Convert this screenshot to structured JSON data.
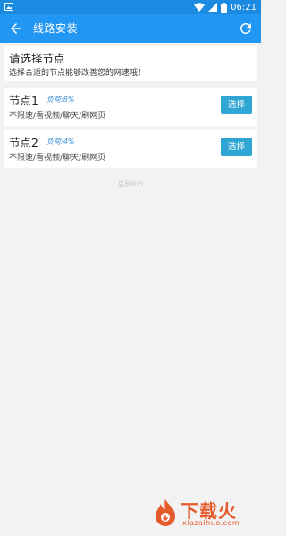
{
  "status_bar": {
    "time": "06:21",
    "icons": [
      "image-notification-icon",
      "wifi-icon",
      "signal-icon",
      "battery-icon"
    ]
  },
  "app_bar": {
    "title": "线路安装",
    "back_icon": "arrow-left-icon",
    "refresh_icon": "refresh-icon",
    "background": "#2196f3"
  },
  "intro": {
    "heading": "请选择节点",
    "subtitle": "选择合适的节点能够改善您的网速哦！"
  },
  "nodes": [
    {
      "name": "节点1",
      "load": "负荷:8%",
      "description": "不限速/看视频/聊天/刷网页",
      "button": "选择"
    },
    {
      "name": "节点2",
      "load": "负荷:4%",
      "description": "不限速/看视频/聊天/刷网页",
      "button": "选择"
    }
  ],
  "footer": {
    "text": "星辰WiFi"
  },
  "watermark": {
    "text": "下载火",
    "sub": "xiazaihuo.com"
  },
  "colors": {
    "accent": "#2196f3",
    "button": "#2fa6d3",
    "load_text": "#3a8ed8",
    "watermark": "#e55a2b"
  }
}
